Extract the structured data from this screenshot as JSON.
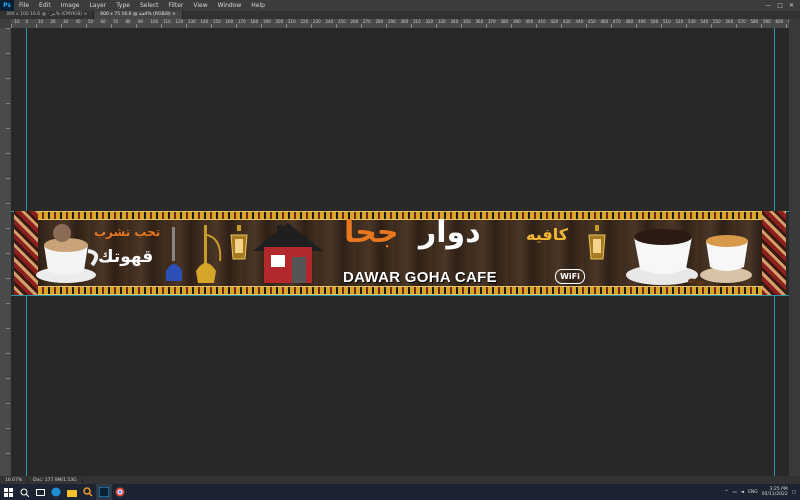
{
  "app": {
    "menu": [
      "File",
      "Edit",
      "Image",
      "Layer",
      "Type",
      "Select",
      "Filter",
      "View",
      "Window",
      "Help"
    ],
    "window_controls": [
      "—",
      "□",
      "✕"
    ]
  },
  "tabs": [
    {
      "label": "300 x 100 بنر - @ 16.6% (CMYK/8)",
      "close": "×"
    },
    {
      "label": "600 x 75 لافتة @ 16.6% (RGB/8)",
      "close": "×"
    }
  ],
  "ruler_labels": [
    "-10",
    "0",
    "10",
    "20",
    "30",
    "40",
    "50",
    "60",
    "70",
    "80",
    "90",
    "100",
    "110",
    "120",
    "130",
    "140",
    "150",
    "160",
    "170",
    "180",
    "190",
    "200",
    "210",
    "220",
    "230",
    "240",
    "250",
    "260",
    "270",
    "280",
    "290",
    "300",
    "310",
    "320",
    "330",
    "340",
    "350",
    "360",
    "370",
    "380",
    "390",
    "400",
    "410",
    "420",
    "430",
    "440",
    "450",
    "460",
    "470",
    "480",
    "490",
    "500",
    "510",
    "520",
    "530",
    "540",
    "550",
    "560",
    "570",
    "580",
    "590",
    "600",
    "610",
    "620"
  ],
  "banner": {
    "arabic_tagline_top": "تحب تشرب",
    "arabic_tagline_bottom": "قهوتك",
    "arabic_title_word1": "كافيه",
    "arabic_title_word2": "دوار",
    "arabic_title_word3": "جحا",
    "english_title": "DAWAR GOHA CAFE",
    "wifi_label": "WiFi",
    "colors": {
      "gold": "#f2b733",
      "orange": "#e8771f",
      "wood": "#3b2a1e",
      "house_red": "#b3282d",
      "white": "#ffffff"
    }
  },
  "status": {
    "zoom": "16.67%",
    "doc_info": "Doc: 177.9M/1.53G"
  },
  "taskbar": {
    "icons": [
      "windows-start-icon",
      "search-icon",
      "task-view-icon",
      "edge-icon",
      "file-explorer-icon",
      "search-app-icon",
      "photoshop-icon",
      "chrome-icon"
    ],
    "language": "ENG",
    "time": "3:25 PM",
    "date": "05/11/2022"
  }
}
